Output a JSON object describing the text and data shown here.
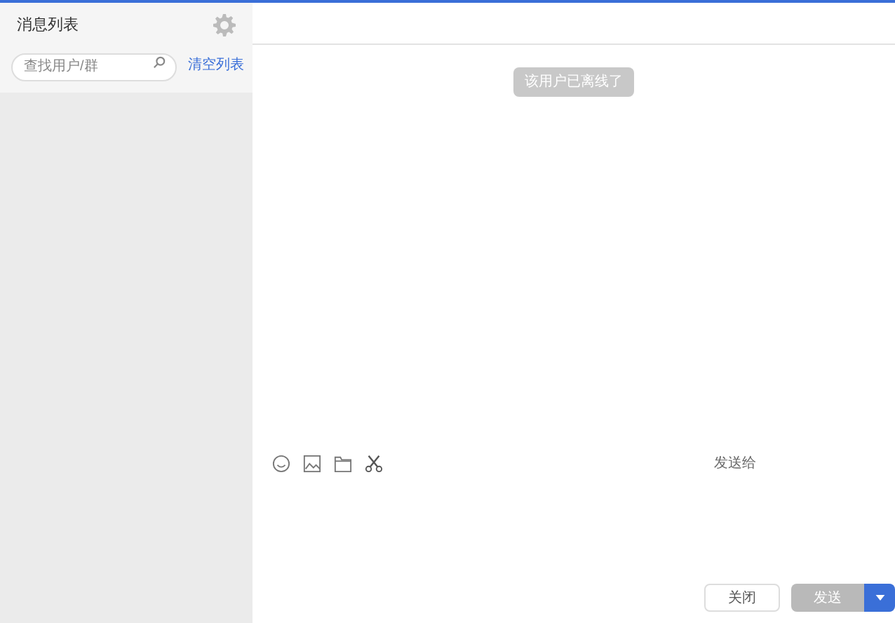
{
  "sidebar": {
    "title": "消息列表",
    "search": {
      "placeholder": "查找用户/群"
    },
    "clear_link": "清空列表"
  },
  "chat": {
    "notice": "该用户已离线了",
    "send_to_label": "发送给",
    "buttons": [
      {
        "label": "关闭",
        "kind": "plain"
      },
      {
        "label": "发送",
        "kind": "primary"
      }
    ]
  }
}
